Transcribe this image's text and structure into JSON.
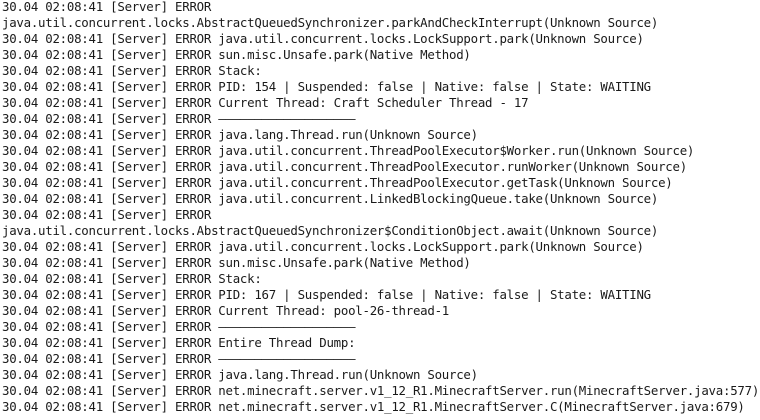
{
  "console": {
    "lines": [
      "30.04 02:08:41 [Server] ERROR",
      "java.util.concurrent.locks.AbstractQueuedSynchronizer.parkAndCheckInterrupt(Unknown Source)",
      "30.04 02:08:41 [Server] ERROR java.util.concurrent.locks.LockSupport.park(Unknown Source)",
      "30.04 02:08:41 [Server] ERROR sun.misc.Unsafe.park(Native Method)",
      "30.04 02:08:41 [Server] ERROR Stack:",
      "30.04 02:08:41 [Server] ERROR PID: 154 | Suspended: false | Native: false | State: WAITING",
      "30.04 02:08:41 [Server] ERROR Current Thread: Craft Scheduler Thread - 17",
      "30.04 02:08:41 [Server] ERROR ———————————————————",
      "30.04 02:08:41 [Server] ERROR java.lang.Thread.run(Unknown Source)",
      "30.04 02:08:41 [Server] ERROR java.util.concurrent.ThreadPoolExecutor$Worker.run(Unknown Source)",
      "30.04 02:08:41 [Server] ERROR java.util.concurrent.ThreadPoolExecutor.runWorker(Unknown Source)",
      "30.04 02:08:41 [Server] ERROR java.util.concurrent.ThreadPoolExecutor.getTask(Unknown Source)",
      "30.04 02:08:41 [Server] ERROR java.util.concurrent.LinkedBlockingQueue.take(Unknown Source)",
      "30.04 02:08:41 [Server] ERROR",
      "java.util.concurrent.locks.AbstractQueuedSynchronizer$ConditionObject.await(Unknown Source)",
      "30.04 02:08:41 [Server] ERROR java.util.concurrent.locks.LockSupport.park(Unknown Source)",
      "30.04 02:08:41 [Server] ERROR sun.misc.Unsafe.park(Native Method)",
      "30.04 02:08:41 [Server] ERROR Stack:",
      "30.04 02:08:41 [Server] ERROR PID: 167 | Suspended: false | Native: false | State: WAITING",
      "30.04 02:08:41 [Server] ERROR Current Thread: pool-26-thread-1",
      "30.04 02:08:41 [Server] ERROR ———————————————————",
      "30.04 02:08:41 [Server] ERROR Entire Thread Dump:",
      "30.04 02:08:41 [Server] ERROR ———————————————————",
      "30.04 02:08:41 [Server] ERROR java.lang.Thread.run(Unknown Source)",
      "30.04 02:08:41 [Server] ERROR net.minecraft.server.v1_12_R1.MinecraftServer.run(MinecraftServer.java:577)",
      "30.04 02:08:41 [Server] ERROR net.minecraft.server.v1_12_R1.MinecraftServer.C(MinecraftServer.java:679)"
    ]
  }
}
